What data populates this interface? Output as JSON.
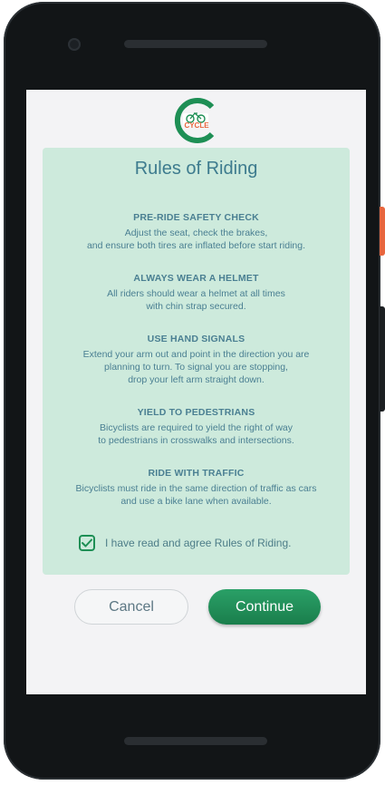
{
  "app": {
    "logo_text": "CYCLE",
    "colors": {
      "brand_green": "#1e8f55",
      "accent_orange": "#e8663e",
      "card_bg": "#cdeadc",
      "text_teal": "#4a7f92"
    }
  },
  "dialog": {
    "title": "Rules of Riding",
    "rules": [
      {
        "title": "PRE-RIDE SAFETY CHECK",
        "lines": [
          "Adjust the seat, check the brakes,",
          "and ensure both tires are inflated before start riding."
        ]
      },
      {
        "title": "ALWAYS WEAR A HELMET",
        "lines": [
          "All riders should wear a helmet at all times",
          "with chin strap secured."
        ]
      },
      {
        "title": "USE HAND SIGNALS",
        "lines": [
          "Extend your arm out and point in the direction you are",
          "planning to turn. To signal you are stopping,",
          "drop your left arm straight down."
        ]
      },
      {
        "title": "YIELD TO PEDESTRIANS",
        "lines": [
          "Bicyclists are required to yield the right of way",
          "to pedestrians in crosswalks and intersections."
        ]
      },
      {
        "title": "RIDE WITH TRAFFIC",
        "lines": [
          "Bicyclists must ride in the same direction of traffic as cars",
          "and use a bike lane when available."
        ]
      }
    ],
    "agree": {
      "label": "I have read and agree Rules of Riding.",
      "checked": true
    }
  },
  "buttons": {
    "cancel_label": "Cancel",
    "continue_label": "Continue"
  }
}
